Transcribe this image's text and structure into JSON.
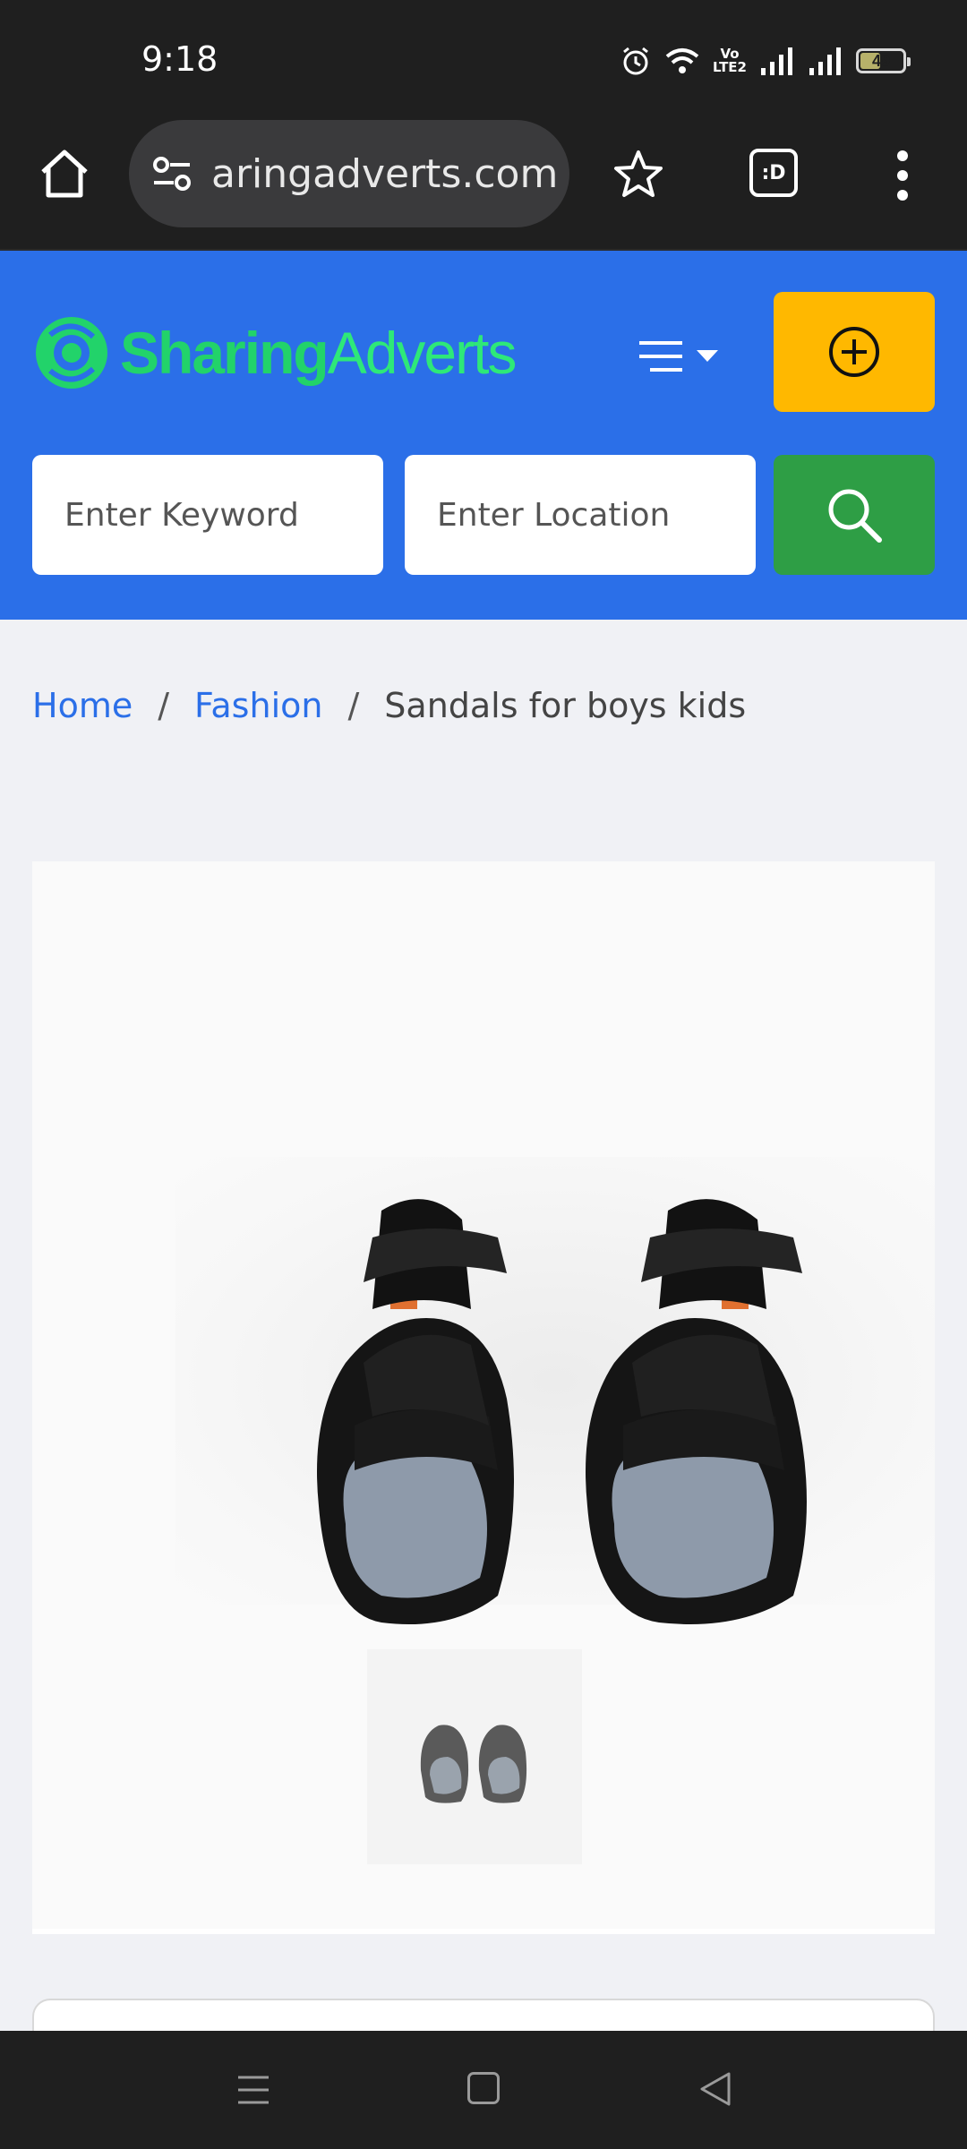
{
  "status_bar": {
    "time": "9:18",
    "network_label": "Vo\nLTE2",
    "battery_level": 49,
    "battery_text": "49",
    "icons": [
      "alarm-icon",
      "wifi-icon",
      "volte-icon",
      "signal-icon",
      "signal-icon",
      "battery-icon"
    ]
  },
  "browser": {
    "url": "aringadverts.com",
    "tabs_label": ":D",
    "icons": [
      "home-icon",
      "site-settings-icon",
      "bookmark-star-icon",
      "tabs-icon",
      "more-menu-icon"
    ]
  },
  "site": {
    "logo_part1": "Sharing",
    "logo_part2": "Adverts",
    "keyword_placeholder": "Enter Keyword",
    "location_placeholder": "Enter Location",
    "colors": {
      "header_bg": "#2b6fe8",
      "post_button": "#ffb800",
      "search_button": "#2e9e45",
      "logo_green": "#22d36a"
    }
  },
  "breadcrumb": {
    "home": "Home",
    "category": "Fashion",
    "separator": "/",
    "current": "Sandals for boys kids"
  },
  "product": {
    "image_subject": "black kids sandals",
    "thumbnail_count": 1
  },
  "nav_bar": {
    "icons": [
      "recents-icon",
      "home-nav-icon",
      "back-icon"
    ]
  }
}
